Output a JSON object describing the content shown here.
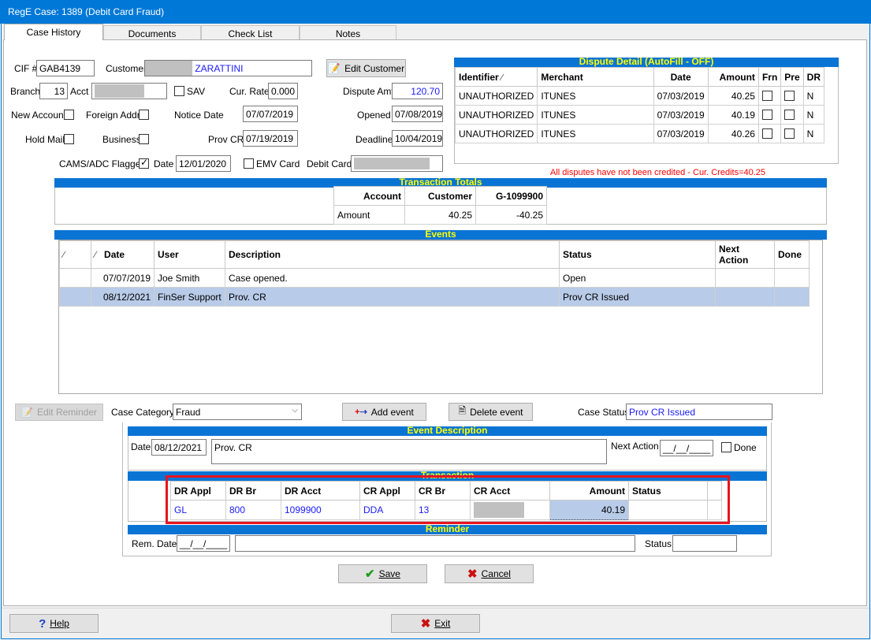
{
  "window": {
    "title": "RegE Case: 1389 (Debit Card Fraud)"
  },
  "tabs": [
    "Case History",
    "Documents",
    "Check List",
    "Notes"
  ],
  "form": {
    "cif_label": "CIF #",
    "cif": "GAB4139",
    "customer_label": "Customer",
    "customer": "ZARATTINI",
    "edit_customer": "Edit Customer",
    "branch_label": "Branch",
    "branch": "13",
    "acct_label": "Acct",
    "sav_label": "SAV",
    "cur_rate_label": "Cur. Rate",
    "cur_rate": "0.000",
    "dispute_amt_label": "Dispute Amt",
    "dispute_amt": "120.70",
    "new_account_label": "New Account",
    "foreign_addr_label": "Foreign Addr",
    "notice_date_label": "Notice Date",
    "notice_date": "07/07/2019",
    "opened_label": "Opened",
    "opened": "07/08/2019",
    "hold_mail_label": "Hold Mail",
    "business_label": "Business",
    "prov_cr_label": "Prov CR",
    "prov_cr": "07/19/2019",
    "deadline_label": "Deadline",
    "deadline": "10/04/2019",
    "cams_label": "CAMS/ADC Flagged",
    "date_label": "Date",
    "cams_date": "12/01/2020",
    "emv_label": "EMV Card",
    "debit_card_label": "Debit Card"
  },
  "dispute_detail": {
    "title": "Dispute Detail (AutoFill - OFF)",
    "columns": [
      "Identifier",
      "Merchant",
      "Date",
      "Amount",
      "Frn",
      "Pre",
      "DR"
    ],
    "rows": [
      {
        "identifier": "UNAUTHORIZED",
        "merchant": "ITUNES",
        "date": "07/03/2019",
        "amount": "40.25",
        "dr": "N"
      },
      {
        "identifier": "UNAUTHORIZED",
        "merchant": "ITUNES",
        "date": "07/03/2019",
        "amount": "40.19",
        "dr": "N"
      },
      {
        "identifier": "UNAUTHORIZED",
        "merchant": "ITUNES",
        "date": "07/03/2019",
        "amount": "40.26",
        "dr": "N"
      }
    ],
    "warning": "All disputes have not been credited - Cur. Credits=40.25"
  },
  "transaction_totals": {
    "title": "Transaction Totals",
    "columns": [
      "Account",
      "Customer",
      "G-1099900"
    ],
    "row": {
      "label": "Amount",
      "customer": "40.25",
      "g": "-40.25"
    }
  },
  "events": {
    "title": "Events",
    "columns": [
      "",
      "",
      "Date",
      "User",
      "Description",
      "Status",
      "Next Action",
      "Done"
    ],
    "rows": [
      {
        "date": "07/07/2019",
        "user": "Joe Smith",
        "description": "Case opened.",
        "status": "Open"
      },
      {
        "date": "08/12/2021",
        "user": "FinSer Support",
        "description": "Prov. CR",
        "status": "Prov CR Issued"
      }
    ]
  },
  "actions": {
    "edit_reminder": "Edit Reminder",
    "case_category_label": "Case Category",
    "case_category": "Fraud",
    "add_event": "Add event",
    "delete_event": "Delete event",
    "case_status_label": "Case Status",
    "case_status": "Prov CR Issued"
  },
  "event_description": {
    "title": "Event Description",
    "date_label": "Date",
    "date": "08/12/2021",
    "text": "Prov. CR",
    "next_action_label": "Next Action",
    "next_action": "__/__/____",
    "done_label": "Done"
  },
  "transaction": {
    "title": "Transaction",
    "columns": [
      "DR Appl",
      "DR Br",
      "DR Acct",
      "CR Appl",
      "CR Br",
      "CR Acct",
      "Amount",
      "Status"
    ],
    "row": {
      "dr_appl": "GL",
      "dr_br": "800",
      "dr_acct": "1099900",
      "cr_appl": "DDA",
      "cr_br": "13",
      "amount": "40.19"
    }
  },
  "reminder": {
    "title": "Reminder",
    "rem_date_label": "Rem. Date",
    "rem_date": "__/__/____",
    "status_label": "Status"
  },
  "buttons": {
    "save": "Save",
    "cancel": "Cancel",
    "help": "Help",
    "exit": "Exit"
  },
  "colors": {
    "banner": "#0a74d4",
    "banner_text": "#ffff00",
    "highlight": "#b8cbe8",
    "alert": "#ff0000",
    "focus_box": "#e8141e"
  }
}
